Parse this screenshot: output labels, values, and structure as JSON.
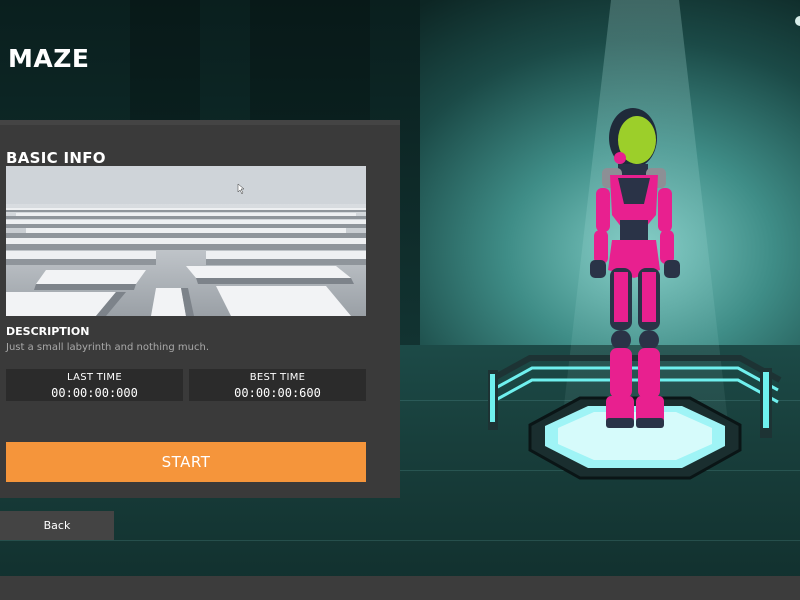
{
  "title": "MAZE",
  "panel": {
    "heading": "BASIC INFO",
    "preview_image": "maze-preview",
    "description_label": "DESCRIPTION",
    "description_text": "Just a small labyrinth and nothing much.",
    "last_time": {
      "label": "LAST TIME",
      "value": "00:00:00:000"
    },
    "best_time": {
      "label": "BEST TIME",
      "value": "00:00:00:600"
    }
  },
  "buttons": {
    "start_label": "START",
    "back_label": "Back"
  },
  "scene": {
    "character": "pink-armored-character",
    "platform": "glowing-octagon-platform"
  },
  "colors": {
    "accent": "#f5953b",
    "panel": "#3a3a3a",
    "time_box": "#2b2b2b",
    "character_armor": "#e8208f",
    "helmet": "#9ccf2a",
    "platform_glow": "#9ff4f6"
  }
}
